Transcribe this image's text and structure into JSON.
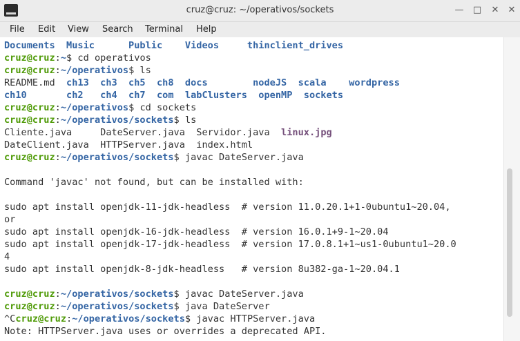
{
  "window": {
    "title": "cruz@cruz: ~/operativos/sockets"
  },
  "menu": {
    "items": [
      "File",
      "Edit",
      "View",
      "Search",
      "Terminal",
      "Help"
    ]
  },
  "terminal": {
    "lines": [
      [
        [
          "Documents  Music      Public    Videos     thinclient_drives",
          "b"
        ]
      ],
      [
        [
          "cruz@cruz",
          "g"
        ],
        [
          ":",
          ""
        ],
        [
          "~",
          "b"
        ],
        [
          "$ cd operativos",
          ""
        ]
      ],
      [
        [
          "cruz@cruz",
          "g"
        ],
        [
          ":",
          ""
        ],
        [
          "~/operativos",
          "b"
        ],
        [
          "$ ls",
          ""
        ]
      ],
      [
        [
          "README.md  ",
          ""
        ],
        [
          "ch13  ch3  ch5  ch8  docs        nodeJS  scala    wordpress",
          "b"
        ]
      ],
      [
        [
          "ch10       ch2   ch4  ch7  com  labClusters  openMP  sockets",
          "b"
        ]
      ],
      [
        [
          "cruz@cruz",
          "g"
        ],
        [
          ":",
          ""
        ],
        [
          "~/operativos",
          "b"
        ],
        [
          "$ cd sockets",
          ""
        ]
      ],
      [
        [
          "cruz@cruz",
          "g"
        ],
        [
          ":",
          ""
        ],
        [
          "~/operativos/sockets",
          "b"
        ],
        [
          "$ ls",
          ""
        ]
      ],
      [
        [
          "Cliente.java     DateServer.java  Servidor.java  ",
          ""
        ],
        [
          "linux.jpg",
          "m"
        ]
      ],
      [
        [
          "DateClient.java  HTTPServer.java  index.html",
          ""
        ]
      ],
      [
        [
          "cruz@cruz",
          "g"
        ],
        [
          ":",
          ""
        ],
        [
          "~/operativos/sockets",
          "b"
        ],
        [
          "$ javac DateServer.java",
          ""
        ]
      ],
      [
        [
          "",
          ""
        ]
      ],
      [
        [
          "Command 'javac' not found, but can be installed with:",
          ""
        ]
      ],
      [
        [
          "",
          ""
        ]
      ],
      [
        [
          "sudo apt install openjdk-11-jdk-headless  # version 11.0.20.1+1-0ubuntu1~20.04,",
          ""
        ]
      ],
      [
        [
          "or",
          ""
        ]
      ],
      [
        [
          "sudo apt install openjdk-16-jdk-headless  # version 16.0.1+9-1~20.04",
          ""
        ]
      ],
      [
        [
          "sudo apt install openjdk-17-jdk-headless  # version 17.0.8.1+1~us1-0ubuntu1~20.0",
          ""
        ]
      ],
      [
        [
          "4",
          ""
        ]
      ],
      [
        [
          "sudo apt install openjdk-8-jdk-headless   # version 8u382-ga-1~20.04.1",
          ""
        ]
      ],
      [
        [
          "",
          ""
        ]
      ],
      [
        [
          "cruz@cruz",
          "g"
        ],
        [
          ":",
          ""
        ],
        [
          "~/operativos/sockets",
          "b"
        ],
        [
          "$ javac DateServer.java",
          ""
        ]
      ],
      [
        [
          "cruz@cruz",
          "g"
        ],
        [
          ":",
          ""
        ],
        [
          "~/operativos/sockets",
          "b"
        ],
        [
          "$ java DateServer",
          ""
        ]
      ],
      [
        [
          "^C",
          ""
        ],
        [
          "cruz@cruz",
          "g"
        ],
        [
          ":",
          ""
        ],
        [
          "~/operativos/sockets",
          "b"
        ],
        [
          "$ javac HTTPServer.java",
          ""
        ]
      ],
      [
        [
          "Note: HTTPServer.java uses or overrides a deprecated API.",
          ""
        ]
      ]
    ]
  },
  "colors": {
    "prompt_user": "#4e9a06",
    "directory": "#3465a4",
    "image_file": "#75507b"
  },
  "icons": {
    "app": "terminal-icon",
    "minimize": "minimize-icon",
    "maximize": "maximize-icon",
    "close": "close-icon"
  }
}
